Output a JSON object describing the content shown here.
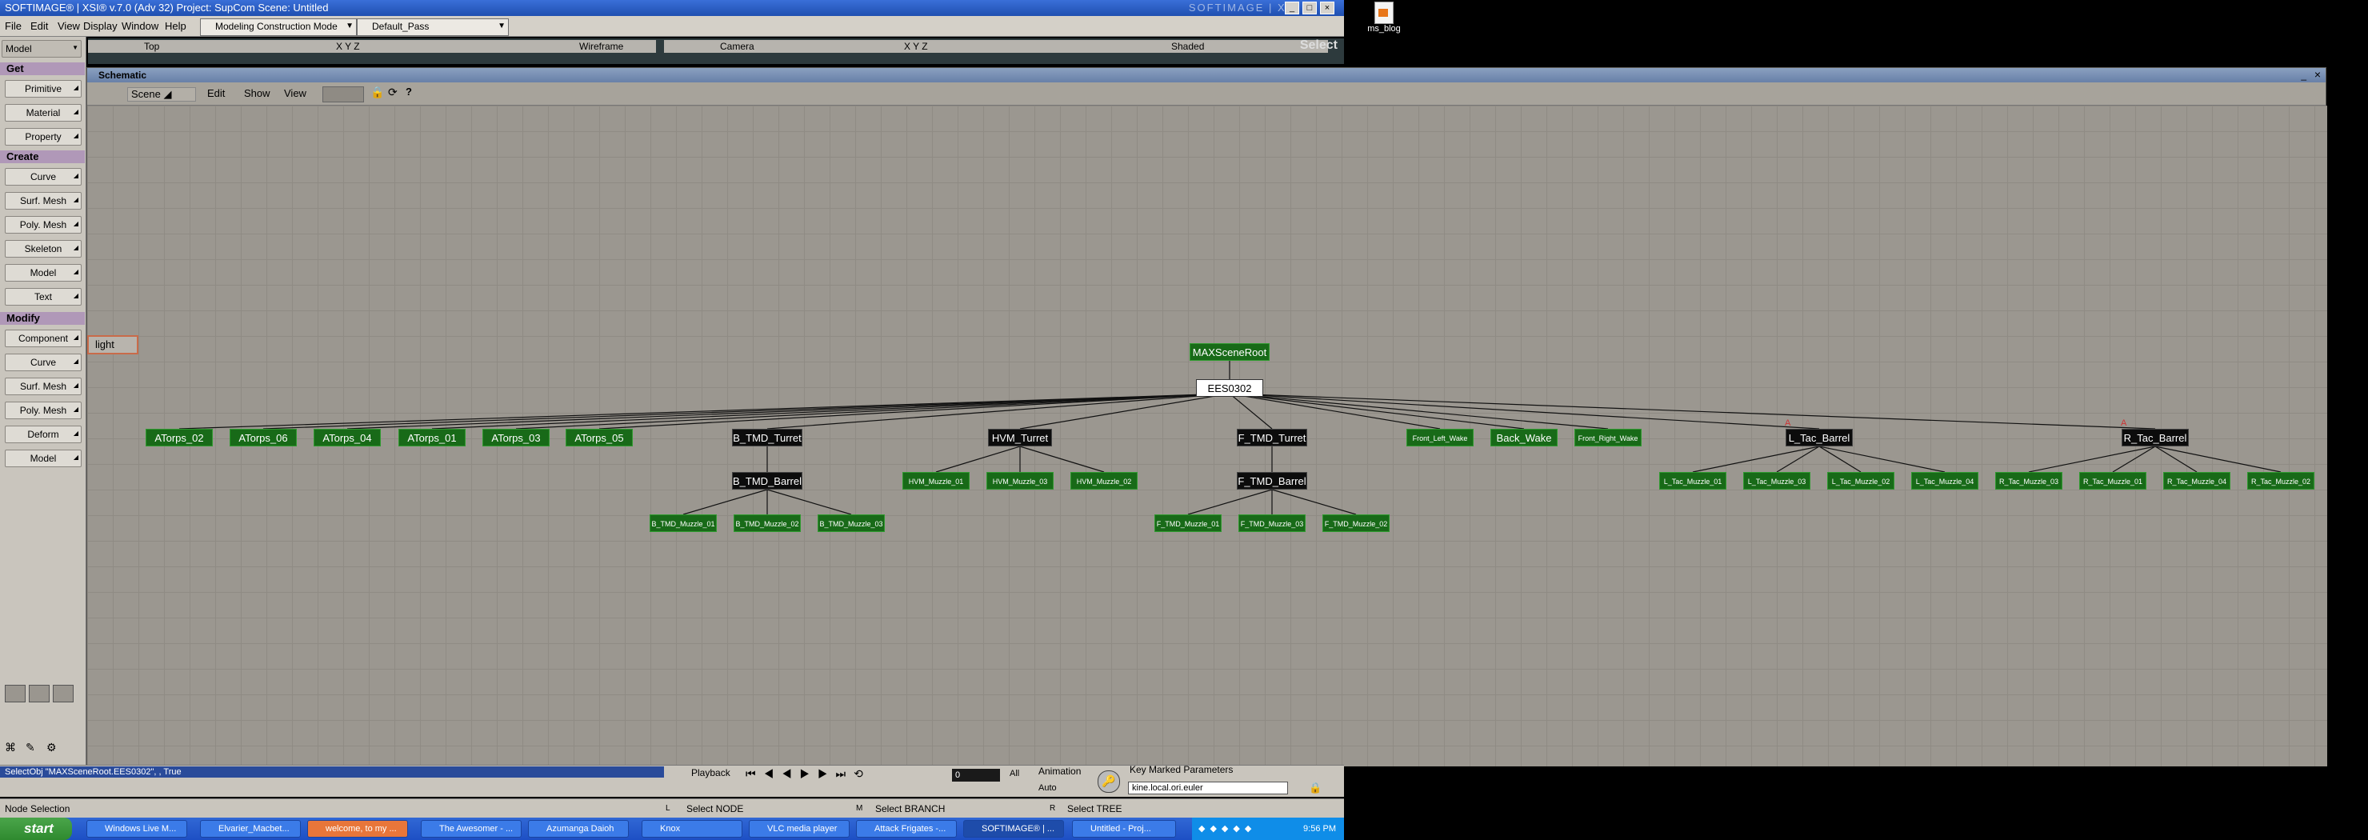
{
  "window": {
    "title": "SOFTIMAGE® | XSI® v.7.0 (Adv 32) Project: SupCom    Scene: Untitled",
    "brand": "SOFTIMAGE | XSI",
    "minimize": "_",
    "maximize": "□",
    "close": "×"
  },
  "menubar": {
    "items": [
      "File",
      "Edit",
      "View",
      "Display",
      "Window",
      "Help"
    ],
    "mode_combo": "Modeling Construction Mode",
    "pass_combo": "Default_Pass",
    "select_label": "Select"
  },
  "viewports": {
    "left": {
      "view": "Top",
      "xyz": "X Y Z",
      "display": "Wireframe"
    },
    "right": {
      "view": "Camera",
      "xyz": "X Y Z",
      "display": "Shaded"
    }
  },
  "left_toolbar": {
    "mode": "Model",
    "categories": {
      "get": "Get",
      "create": "Create",
      "modify": "Modify"
    },
    "get_buttons": [
      "Primitive",
      "Material",
      "Property"
    ],
    "create_buttons": [
      "Curve",
      "Surf. Mesh",
      "Poly. Mesh",
      "Skeleton",
      "Model",
      "Text"
    ],
    "modify_buttons": [
      "Component",
      "Curve",
      "Surf. Mesh",
      "Poly. Mesh",
      "Deform",
      "Model"
    ]
  },
  "schematic": {
    "title": "Schematic",
    "toolbar": {
      "scene": "Scene",
      "edit": "Edit",
      "show": "Show",
      "view": "View"
    },
    "light_node": "light",
    "nodes": {
      "root": "MAXSceneRoot",
      "ees": "EES0302",
      "atorps_02": "ATorps_02",
      "atorps_06": "ATorps_06",
      "atorps_04": "ATorps_04",
      "atorps_01": "ATorps_01",
      "atorps_03": "ATorps_03",
      "atorps_05": "ATorps_05",
      "b_tmd_turret": "B_TMD_Turret",
      "b_tmd_barrel": "B_TMD_Barrel",
      "b_tmd_muzzle_01": "B_TMD_Muzzle_01",
      "b_tmd_muzzle_02": "B_TMD_Muzzle_02",
      "b_tmd_muzzle_03": "B_TMD_Muzzle_03",
      "hvm_turret": "HVM_Turret",
      "hvm_muzzle_01": "HVM_Muzzle_01",
      "hvm_muzzle_03": "HVM_Muzzle_03",
      "hvm_muzzle_02": "HVM_Muzzle_02",
      "f_tmd_turret": "F_TMD_Turret",
      "f_tmd_barrel": "F_TMD_Barrel",
      "f_tmd_muzzle_01": "F_TMD_Muzzle_01",
      "f_tmd_muzzle_03": "F_TMD_Muzzle_03",
      "f_tmd_muzzle_02": "F_TMD_Muzzle_02",
      "front_left_wake": "Front_Left_Wake",
      "back_wake": "Back_Wake",
      "front_right_wake": "Front_Right_Wake",
      "l_tac_barrel": "L_Tac_Barrel",
      "l_tac_muzzle_01": "L_Tac_Muzzle_01",
      "l_tac_muzzle_03": "L_Tac_Muzzle_03",
      "l_tac_muzzle_02": "L_Tac_Muzzle_02",
      "l_tac_muzzle_04": "L_Tac_Muzzle_04",
      "r_tac_barrel": "R_Tac_Barrel",
      "r_tac_muzzle_03": "R_Tac_Muzzle_03",
      "r_tac_muzzle_01": "R_Tac_Muzzle_01",
      "r_tac_muzzle_04": "R_Tac_Muzzle_04",
      "r_tac_muzzle_02": "R_Tac_Muzzle_02"
    }
  },
  "timeline": {
    "command": "SelectObj \"MAXSceneRoot.EES0302\", , True",
    "playback": "Playback",
    "frame": "0",
    "all": "All",
    "animation": "Animation",
    "auto": "Auto",
    "key_params": "Key Marked Parameters",
    "param_field": "kine.local.ori.euler"
  },
  "status": {
    "mode": "Node Selection",
    "l_hint": "Select NODE",
    "m_hint": "Select BRANCH",
    "r_hint": "Select TREE",
    "l_key": "L",
    "m_key": "M",
    "r_key": "R"
  },
  "taskbar": {
    "start": "start",
    "tasks": [
      "Windows Live M...",
      "Elvarier_Macbet...",
      "welcome, to my ...",
      "The Awesomer - ...",
      "Azumanga Daioh",
      "Knox",
      "VLC media player",
      "Attack Frigates -...",
      "SOFTIMAGE® | ...",
      "Untitled - Proj..."
    ],
    "clock": "9:56 PM"
  },
  "desktop_icon": "ms_blog"
}
